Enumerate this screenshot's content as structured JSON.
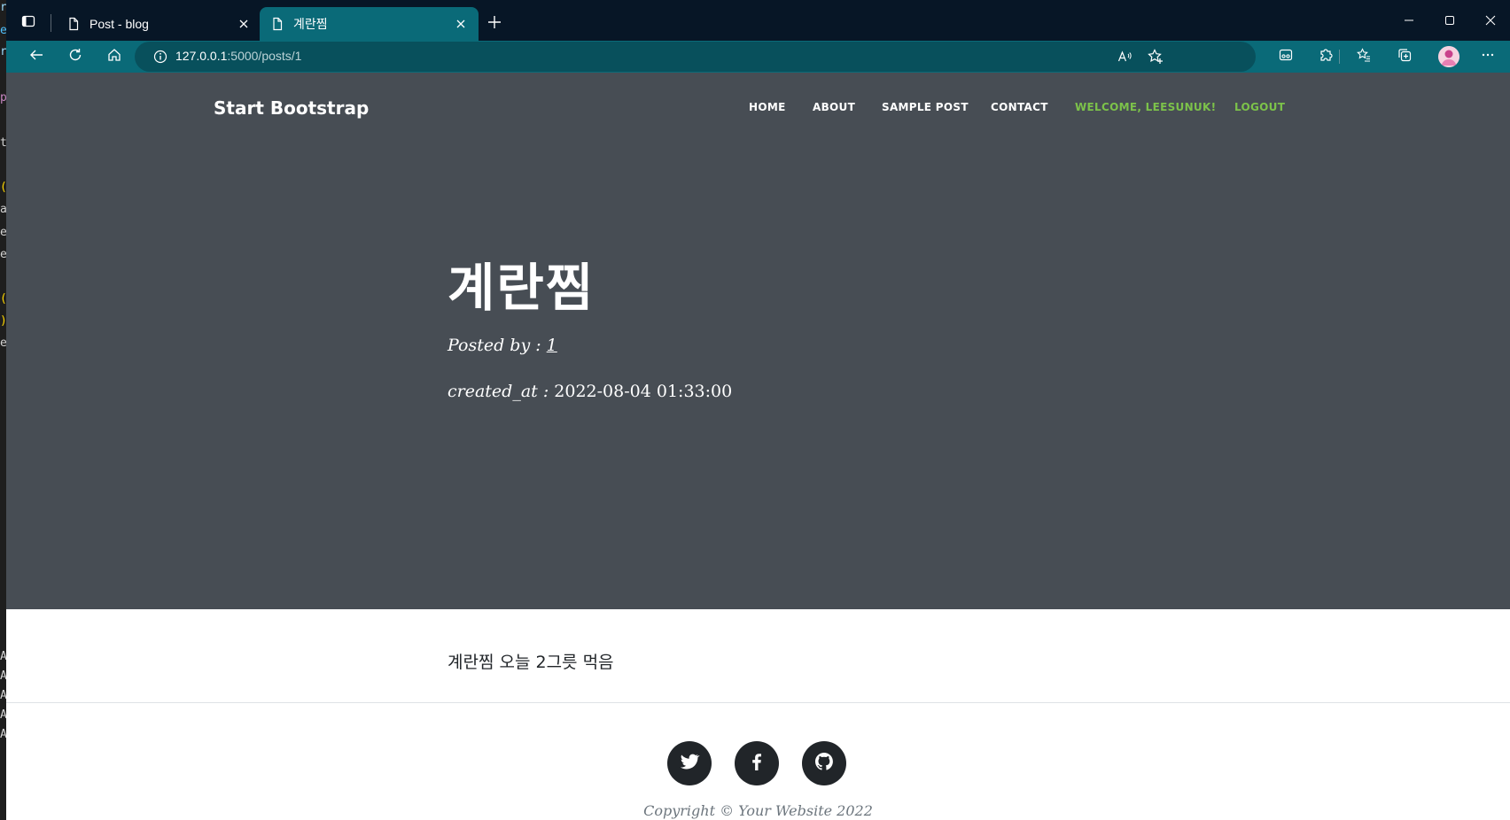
{
  "browser": {
    "tabs": [
      {
        "title": "Post - blog",
        "icon": "page-icon",
        "active": false
      },
      {
        "title": "계란찜",
        "icon": "page-icon",
        "active": true
      }
    ],
    "url_host": "127.0.0.1",
    "url_rest": ":5000/posts/1",
    "colors": {
      "titlebar": "#071626",
      "toolbar": "#0a6a78",
      "address_bar": "#08505c"
    }
  },
  "site": {
    "brand": "Start Bootstrap",
    "nav": [
      {
        "label": "HOME"
      },
      {
        "label": "ABOUT"
      },
      {
        "label": "SAMPLE POST"
      },
      {
        "label": "CONTACT"
      },
      {
        "label": "WELCOME, LEESUNUK!"
      },
      {
        "label": "LOGOUT"
      }
    ],
    "colors": {
      "masthead": "#474d54",
      "nav_highlight": "#7cc24a"
    }
  },
  "post": {
    "title": "계란찜",
    "posted_by_label": "Posted by : ",
    "author": "1",
    "created_label": "created_at : ",
    "created_value": "2022-08-04 01:33:00",
    "body": "계란찜 오늘 2그릇 먹음"
  },
  "footer": {
    "social": [
      {
        "icon": "twitter-icon"
      },
      {
        "icon": "facebook-icon"
      },
      {
        "icon": "github-icon"
      }
    ],
    "copyright": "Copyright © Your Website 2022"
  }
}
